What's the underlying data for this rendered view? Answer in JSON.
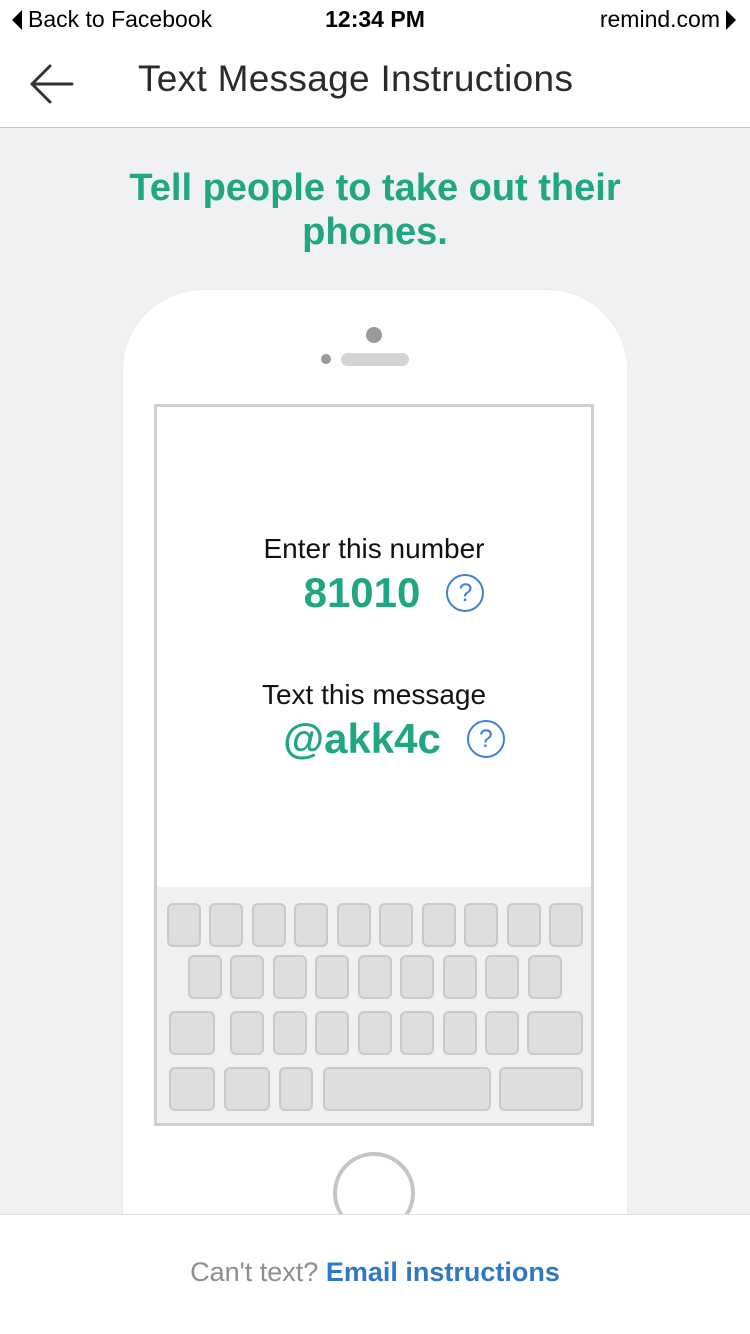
{
  "status_bar": {
    "back_app": "Back to Facebook",
    "time": "12:34 PM",
    "site": "remind.com"
  },
  "nav": {
    "title": "Text Message Instructions",
    "back_icon": "arrow-left-icon"
  },
  "headline": "Tell people to take out their phones.",
  "instructions": {
    "number_label": "Enter this number",
    "number_value": "81010",
    "message_label": "Text this message",
    "message_value": "@akk4c",
    "help_glyph": "?"
  },
  "footer": {
    "prompt": "Can't text?",
    "link": "Email instructions"
  },
  "colors": {
    "accent_green": "#20a683",
    "link_blue": "#2f78c4",
    "help_blue": "#3f82d4"
  }
}
